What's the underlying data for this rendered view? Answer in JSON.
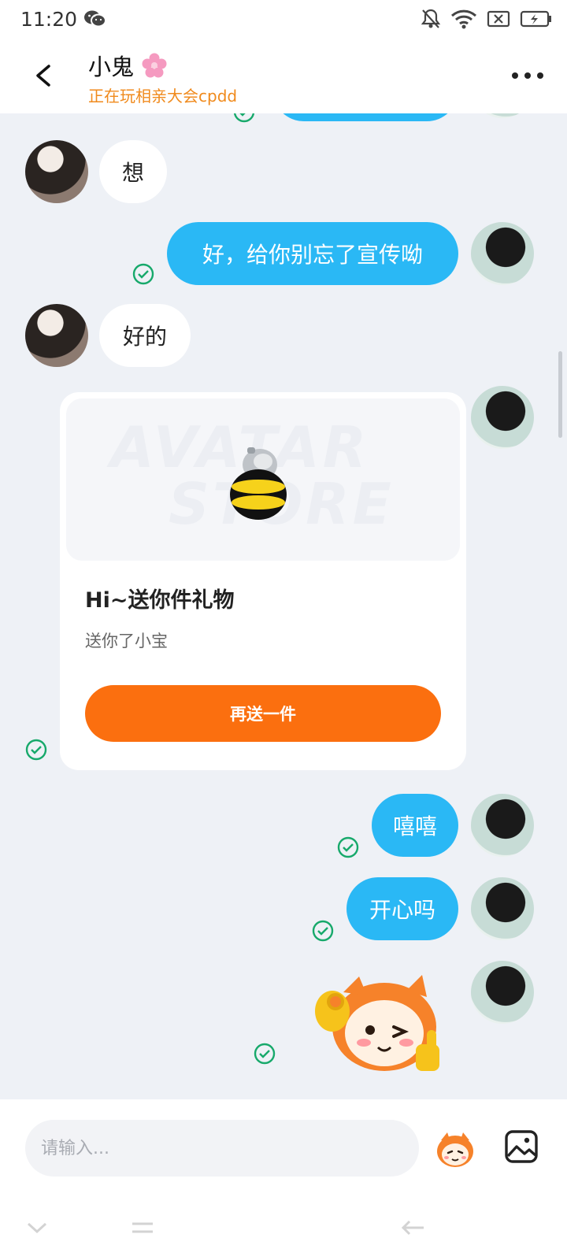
{
  "status_bar": {
    "time": "11:20"
  },
  "header": {
    "name": "小鬼",
    "status": "正在玩相亲大会cpdd"
  },
  "messages": [
    {
      "from": "her",
      "text": "想"
    },
    {
      "from": "me",
      "text": "好，给你别忘了宣传呦"
    },
    {
      "from": "her",
      "text": "好的"
    },
    {
      "from": "me",
      "text": "嘻嘻"
    },
    {
      "from": "me",
      "text": "开心吗"
    }
  ],
  "gift_card": {
    "watermark_line1": "AVATAR",
    "watermark_line2": "STORE",
    "title": "Hi~送你件礼物",
    "description": "送你了小宝",
    "button_label": "再送一件"
  },
  "input": {
    "placeholder": "请输入..."
  },
  "colors": {
    "accent_blue": "#2ab8f5",
    "accent_orange": "#fb6f0f",
    "status_orange": "#f08a1c",
    "read_check_green": "#17a96b"
  }
}
